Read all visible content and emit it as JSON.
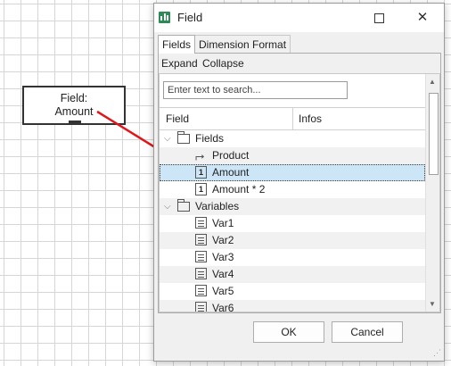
{
  "canvas": {
    "field_box": {
      "line1": "Field:",
      "line2": "Amount"
    },
    "arrow_color": "#e0161a",
    "grid_color": "#d6d6d6"
  },
  "dialog": {
    "title": "Field",
    "app_icon": "bar-chart-icon",
    "controls": {
      "maximize": "maximize-icon",
      "close": "✕"
    },
    "tabs": [
      {
        "label": "Fields",
        "active": true
      },
      {
        "label": "Dimension Format",
        "active": false
      }
    ],
    "toolbar": {
      "expand": "Expand",
      "collapse": "Collapse"
    },
    "search": {
      "placeholder": "Enter text to search...",
      "value": ""
    },
    "columns": {
      "field": "Field",
      "infos": "Infos"
    },
    "tree": [
      {
        "label": "Fields",
        "type": "folder",
        "level": 0,
        "expanded": true
      },
      {
        "label": "Product",
        "type": "hierarchy",
        "level": 1
      },
      {
        "label": "Amount",
        "type": "field",
        "level": 1,
        "selected": true
      },
      {
        "label": "Amount * 2",
        "type": "field",
        "level": 1
      },
      {
        "label": "Variables",
        "type": "folder",
        "level": 0,
        "expanded": true
      },
      {
        "label": "Var1",
        "type": "variable",
        "level": 1
      },
      {
        "label": "Var2",
        "type": "variable",
        "level": 1
      },
      {
        "label": "Var3",
        "type": "variable",
        "level": 1
      },
      {
        "label": "Var4",
        "type": "variable",
        "level": 1
      },
      {
        "label": "Var5",
        "type": "variable",
        "level": 1
      },
      {
        "label": "Var6",
        "type": "variable",
        "level": 1
      }
    ],
    "buttons": {
      "ok": "OK",
      "cancel": "Cancel"
    },
    "colors": {
      "selection": "#cde6f7",
      "app_icon": "#2e8b57"
    }
  }
}
